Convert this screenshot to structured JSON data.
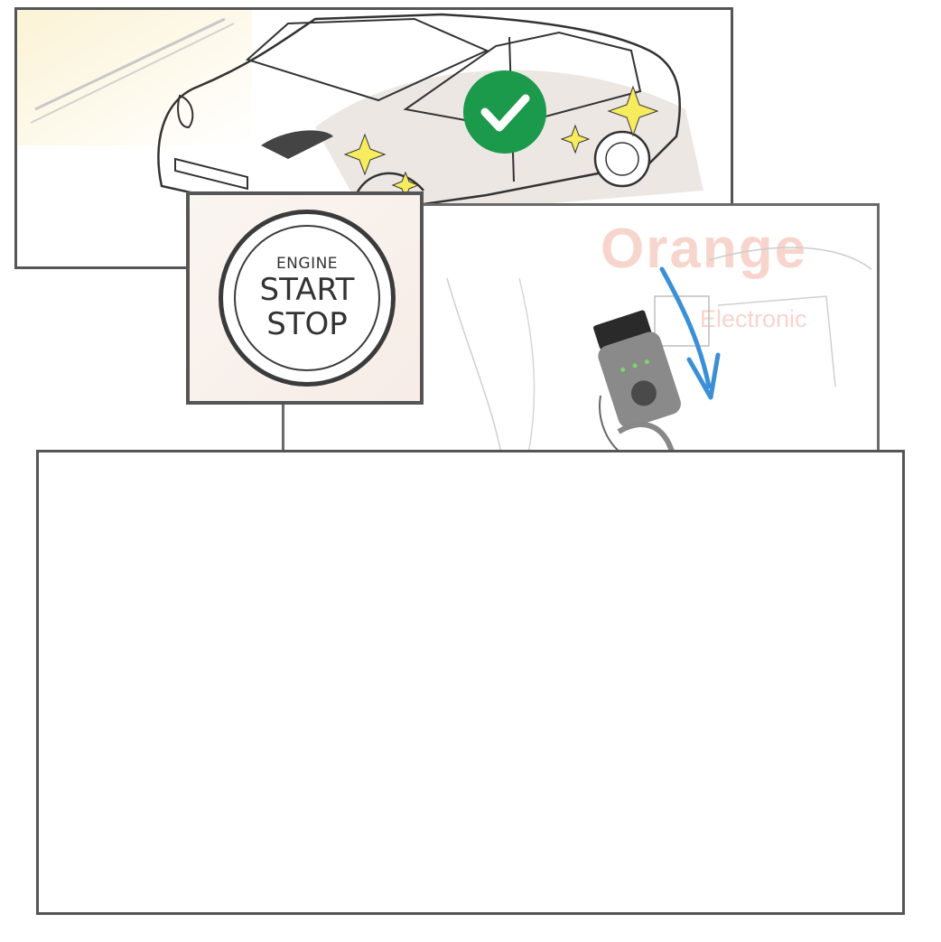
{
  "engine_button": {
    "line1": "ENGINE",
    "line2": "START",
    "line3": "STOP"
  },
  "watermark": {
    "word": "Orange",
    "sub": "Electronic"
  },
  "colors": {
    "frame": "#555555",
    "check_badge": "#1a9a4a",
    "sparkle": "#f7ec5e",
    "arrow": "#3a8fd6",
    "watermark": "#f3b3a3"
  },
  "icons": {
    "status": "check-badge-icon",
    "sparkle": "sparkle-icon",
    "arrow": "arrow-down-icon"
  }
}
